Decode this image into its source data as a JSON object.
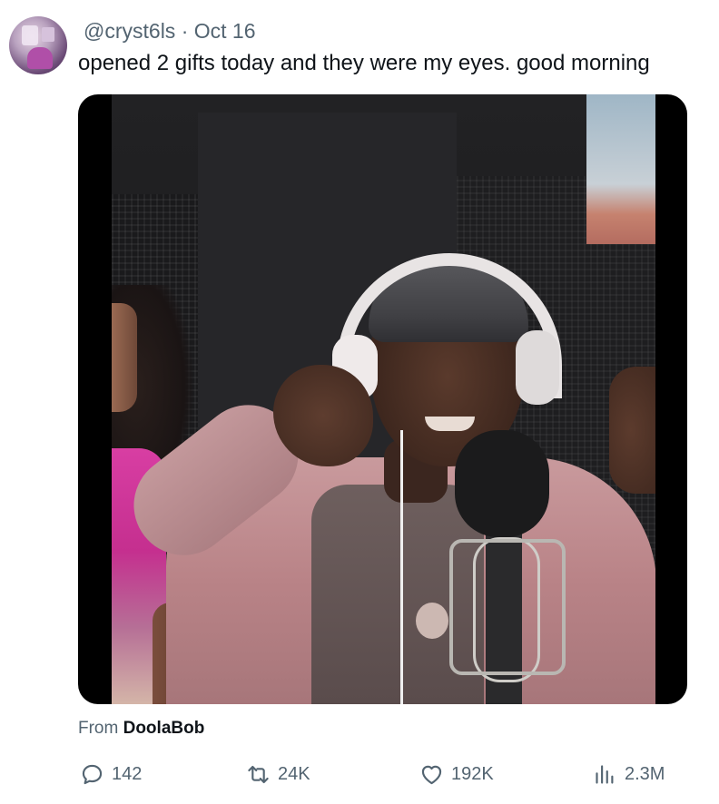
{
  "tweet": {
    "handle": "@cryst6ls",
    "separator": "·",
    "date": "Oct 16",
    "text": "opened 2 gifts today and they were my eyes. good morning"
  },
  "media": {
    "source_prefix": "From",
    "source_name": "DoolaBob"
  },
  "actions": {
    "reply_count": "142",
    "retweet_count": "24K",
    "like_count": "192K",
    "view_count": "2.3M"
  },
  "icons": {
    "reply": "reply-icon",
    "retweet": "retweet-icon",
    "like": "heart-icon",
    "views": "views-icon"
  },
  "colors": {
    "text_primary": "#0f1419",
    "text_secondary": "#536471",
    "background": "#ffffff"
  }
}
